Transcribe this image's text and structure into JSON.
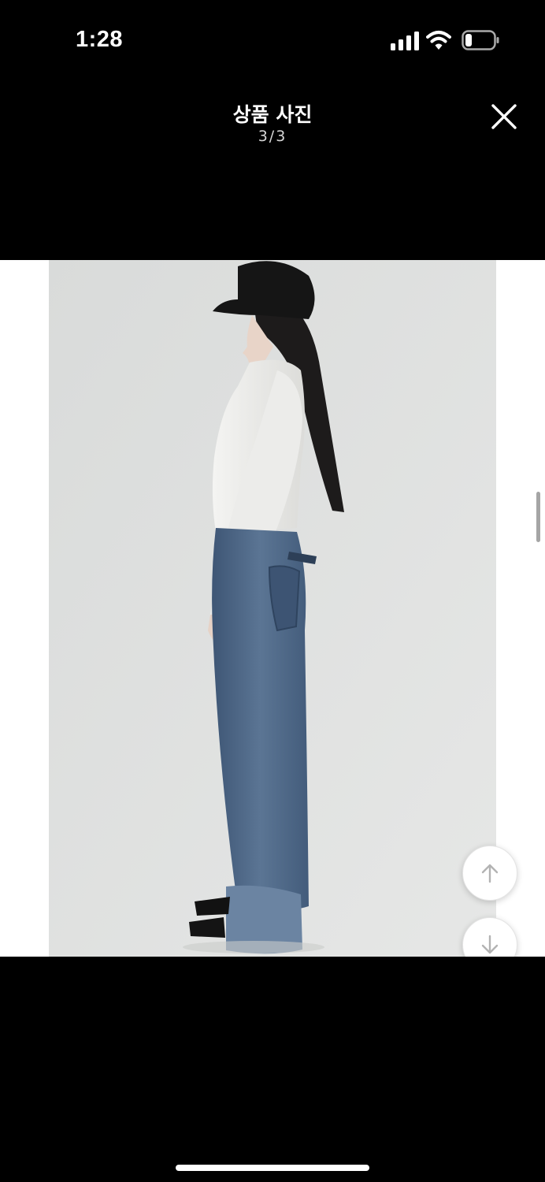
{
  "status_bar": {
    "time": "1:28",
    "icons": [
      "signal-icon",
      "wifi-icon",
      "battery-icon"
    ]
  },
  "header": {
    "title": "상품 사진",
    "counter": "3/3",
    "close_icon": "close-icon"
  },
  "viewer": {
    "photo": "product-photo",
    "scroll_up_icon": "arrow-up-icon",
    "scroll_down_icon": "arrow-down-icon"
  },
  "colors": {
    "background": "#000000",
    "photo_backdrop": "#dcdedd",
    "denim": "#4f6a88"
  }
}
